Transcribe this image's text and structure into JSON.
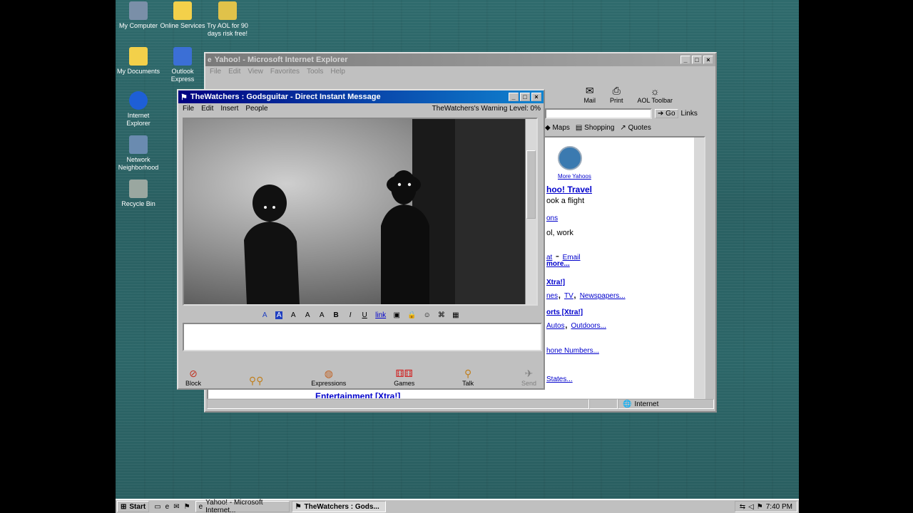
{
  "desktop": {
    "icons": [
      {
        "label": "My Computer",
        "icon": "computer-icon",
        "color": "#7a8fa8"
      },
      {
        "label": "Online Services",
        "icon": "folder-icon",
        "color": "#f3d04a"
      },
      {
        "label": "Try AOL for 90 days risk free!",
        "icon": "aol-icon",
        "color": "#e0c24a"
      },
      {
        "label": "My Documents",
        "icon": "folder-icon",
        "color": "#f3d04a"
      },
      {
        "label": "Outlook Express",
        "icon": "outlook-icon",
        "color": "#3b6fd6"
      },
      {
        "label": "Internet Explorer",
        "icon": "ie-icon",
        "color": "#1e5fd6"
      },
      {
        "label": "Network Neighborhood",
        "icon": "network-icon",
        "color": "#6a8bb0"
      },
      {
        "label": "Recycle Bin",
        "icon": "recycle-bin-icon",
        "color": "#9aa7a0"
      }
    ]
  },
  "ie_window": {
    "title": "Yahoo! - Microsoft Internet Explorer",
    "menu": [
      "File",
      "Edit",
      "View",
      "Favorites",
      "Tools",
      "Help"
    ],
    "toolbar": [
      "Mail",
      "Print",
      "AOL Toolbar"
    ],
    "address_go": "Go",
    "links_label": "Links",
    "links_bar": [
      "Maps",
      "Shopping",
      "Quotes"
    ],
    "page": {
      "more_yahoos": "More Yahoos",
      "heading": "hoo! Travel",
      "book": "ook a flight",
      "ons": "ons",
      "school": "ol, work",
      "chat_email": [
        "at",
        "Email"
      ],
      "more": "more...",
      "xtra1": "Xtra!]",
      "news": [
        "nes",
        "TV",
        "Newspapers..."
      ],
      "sports": "orts [Xtra!]",
      "autos": [
        "Autos",
        "Outdoors..."
      ],
      "phone": "hone Numbers...",
      "states": "States...",
      "entertainment": "Entertainment [Xtra!]"
    },
    "status_zone": "Internet"
  },
  "im_window": {
    "title": "TheWatchers : Godsguitar - Direct Instant Message",
    "menu": [
      "File",
      "Edit",
      "Insert",
      "People"
    ],
    "warning": "TheWatchers's Warning Level: 0%",
    "format_buttons": [
      "A",
      "A",
      "A",
      "A",
      "A",
      "B",
      "I",
      "U",
      "link",
      "img",
      "lock",
      "smile",
      "tag",
      "img2"
    ],
    "bottom_buttons": [
      {
        "label": "Block",
        "icon": "block-icon"
      },
      {
        "label": "",
        "icon": "buddies-icon"
      },
      {
        "label": "Expressions",
        "icon": "expressions-icon"
      },
      {
        "label": "Games",
        "icon": "games-icon"
      },
      {
        "label": "Talk",
        "icon": "talk-icon"
      },
      {
        "label": "Send",
        "icon": "send-icon"
      }
    ]
  },
  "taskbar": {
    "start": "Start",
    "tasks": [
      "Yahoo! - Microsoft Internet...",
      "TheWatchers : Gods..."
    ],
    "clock": "7:40 PM"
  }
}
